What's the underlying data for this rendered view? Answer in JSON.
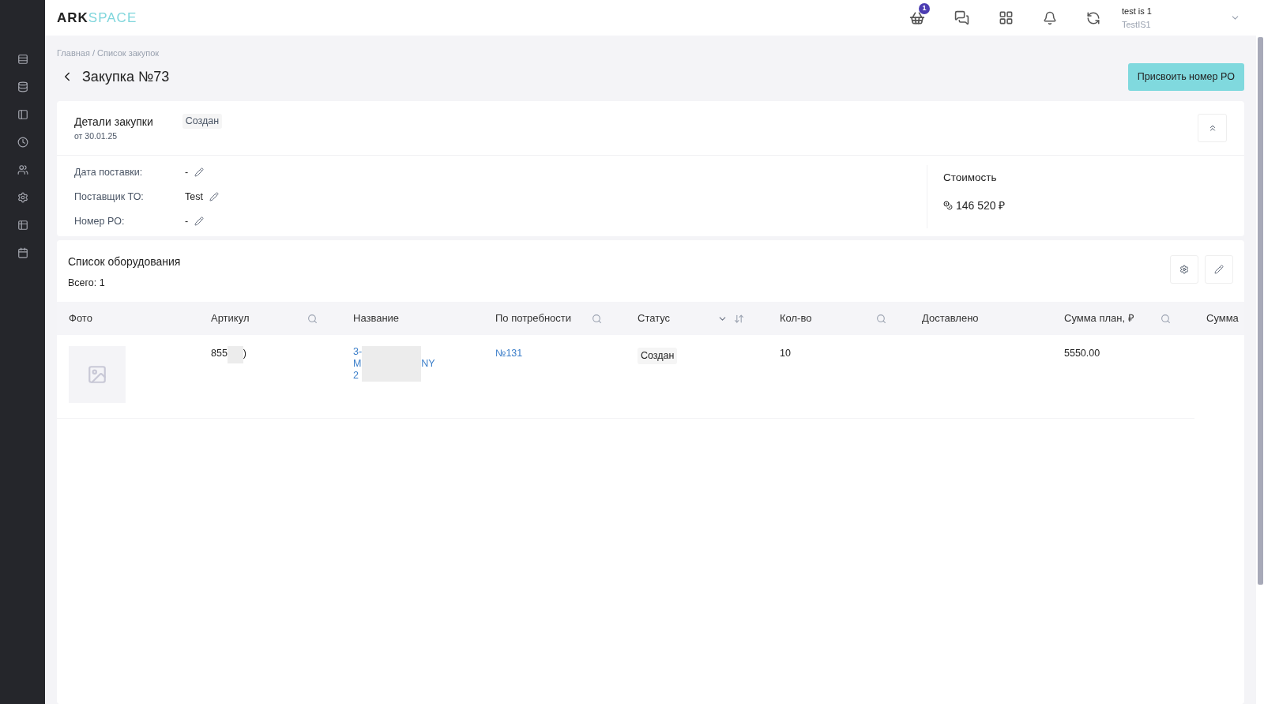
{
  "logo": {
    "bold": "ARK",
    "light": "SPACE"
  },
  "header": {
    "cart_badge": "1",
    "user": {
      "name": "test is 1",
      "org": "TestIS1"
    }
  },
  "breadcrumb": "Главная / Список закупок",
  "page_title": "Закупка №73",
  "assign_button": "Присвоить номер PO",
  "details": {
    "title": "Детали закупки",
    "date": "от 30.01.25",
    "status": "Создан",
    "fields": [
      {
        "label": "Дата поставки:",
        "value": "-"
      },
      {
        "label": "Поставщик ТО:",
        "value": "Test"
      },
      {
        "label": "Номер PO:",
        "value": "-"
      }
    ],
    "cost": {
      "title": "Стоимость",
      "value": "146 520 ₽"
    }
  },
  "equipment": {
    "title": "Список оборудования",
    "total": "Всего: 1",
    "columns": [
      {
        "label": "Фото",
        "kind": "plain"
      },
      {
        "label": "Артикул",
        "kind": "search"
      },
      {
        "label": "Название",
        "kind": "plain"
      },
      {
        "label": "По потребности",
        "kind": "search"
      },
      {
        "label": "Статус",
        "kind": "sort"
      },
      {
        "label": "Кол-во",
        "kind": "search"
      },
      {
        "label": "Доставлено",
        "kind": "plain"
      },
      {
        "label": "Сумма план, ₽",
        "kind": "search"
      },
      {
        "label": "Сумма",
        "kind": "plain"
      }
    ],
    "rows": [
      {
        "article": [
          "855",
          ")"
        ],
        "name": [
          "3-",
          "M",
          "NY",
          "2"
        ],
        "need": "№131",
        "status": "Создан",
        "qty": "10",
        "sum_plan": "5550.00"
      }
    ]
  }
}
